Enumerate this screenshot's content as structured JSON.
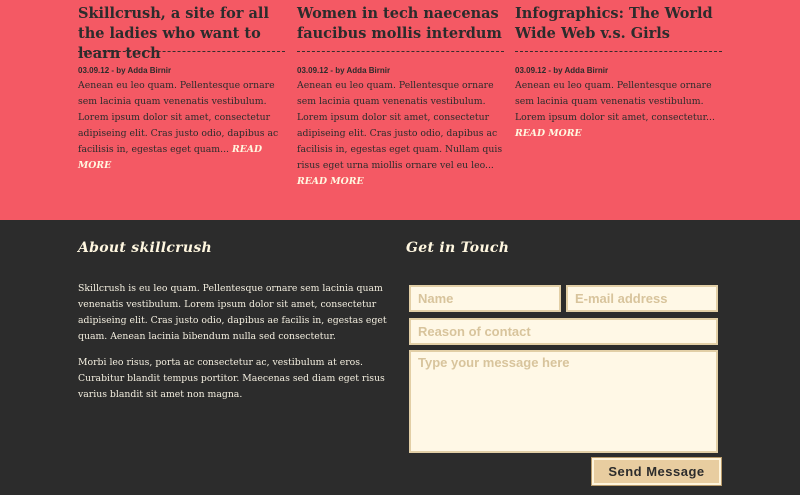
{
  "posts": [
    {
      "title": "Skillcrush, a site for all the ladies who want to learn tech",
      "meta": "03.09.12 - by Adda Birnir",
      "excerpt": "Aenean eu leo quam. Pellentesque ornare sem lacinia quam venenatis vestibulum. Lorem ipsum dolor sit amet, consectetur adipiseing elit. Cras justo odio, dapibus ac facilisis in, egestas eget quam...",
      "read_more": "READ MORE"
    },
    {
      "title": "Women in tech naecenas faucibus mollis interdum",
      "meta": "03.09.12 - by Adda Birnir",
      "excerpt": "Aenean eu leo quam. Pellentesque ornare sem lacinia quam venenatis vestibulum. Lorem ipsum dolor sit amet, consectetur adipiseing elit. Cras justo odio, dapibus ac facilisis in, egestas eget quam. Nullam quis risus eget urna miollis ornare vel eu leo...",
      "read_more": "READ MORE"
    },
    {
      "title": "Infographics: The World Wide Web v.s. Girls",
      "meta": "03.09.12 - by Adda Birnir",
      "excerpt": "Aenean eu leo quam. Pellentesque ornare sem lacinia quam venenatis vestibulum. Lorem ipsum dolor sit amet, consectetur...",
      "read_more": "READ MORE"
    }
  ],
  "footer": {
    "about_title": "About skillcrush",
    "about_paragraphs": [
      "Skillcrush is eu leo quam. Pellentesque ornare sem lacinia quam venenatis vestibulum. Lorem ipsum dolor sit amet, consectetur adipiseing elit. Cras justo odio, dapibus ae facilis in, egestas eget quam. Aenean lacinia bibendum nulla sed consectetur.",
      "Morbi leo risus, porta ac consectetur ac, vestibulum at eros. Curabitur blandit tempus portitor. Maecenas sed diam eget risus varius blandit sit amet non magna."
    ],
    "contact_title": "Get in Touch",
    "form": {
      "name_placeholder": "Name",
      "email_placeholder": "E-mail address",
      "reason_placeholder": "Reason of contact",
      "message_placeholder": "Type your message here",
      "send_label": "Send Message"
    }
  },
  "colors": {
    "blog_background": "#f45964",
    "footer_background": "#2c2c2c",
    "cream": "#fff8e6",
    "button": "#e8cda0"
  }
}
